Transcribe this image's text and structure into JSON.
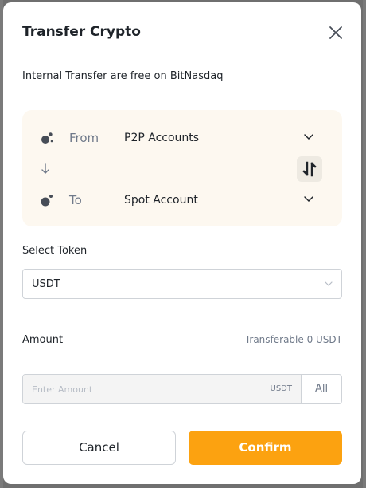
{
  "colors": {
    "accent": "#fca210",
    "overlay": "#6f6f6f",
    "transfer_box_bg": "#fdf8f0",
    "muted_text": "#707a8a"
  },
  "modal": {
    "title": "Transfer Crypto",
    "close_icon": "close-icon",
    "notice": "Internal Transfer are free on BitNasdaq"
  },
  "transfer": {
    "from": {
      "label": "From",
      "value": "P2P Accounts",
      "icon": "from-account-icon"
    },
    "to": {
      "label": "To",
      "value": "Spot Account",
      "icon": "to-account-icon"
    },
    "swap_icon": "swap-icon",
    "direction_icon": "arrow-down-icon"
  },
  "token": {
    "label": "Select Token",
    "selected": "USDT"
  },
  "amount": {
    "label": "Amount",
    "transferable": "Transferable 0 USDT",
    "placeholder": "Enter Amount",
    "value": "",
    "unit": "USDT",
    "all_label": "All"
  },
  "actions": {
    "cancel_label": "Cancel",
    "confirm_label": "Confirm"
  }
}
